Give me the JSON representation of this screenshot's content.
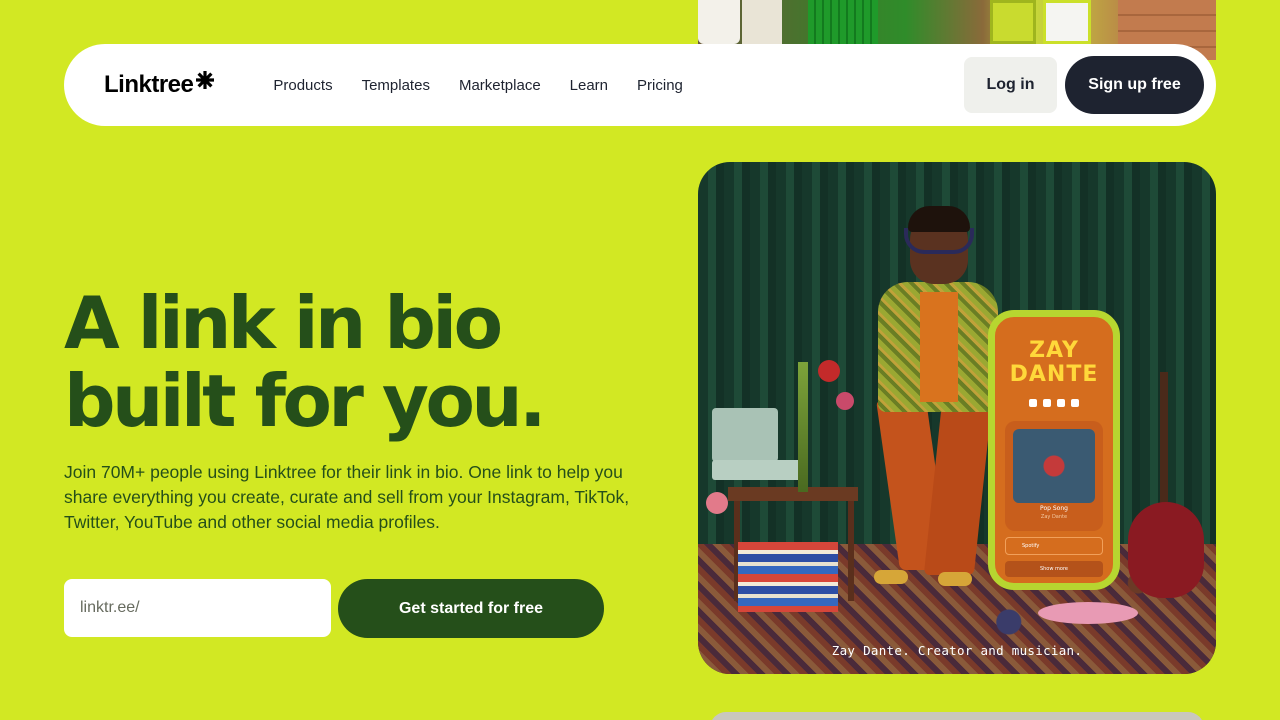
{
  "brand": {
    "logo_text": "Linktree",
    "background_color": "#d2e823",
    "primary_dark_green": "#254f1a",
    "navy": "#1e2330"
  },
  "nav": {
    "links": [
      {
        "label": "Products"
      },
      {
        "label": "Templates"
      },
      {
        "label": "Marketplace"
      },
      {
        "label": "Learn"
      },
      {
        "label": "Pricing"
      }
    ],
    "login_label": "Log in",
    "signup_label": "Sign up free"
  },
  "hero": {
    "title_line1": "A link in bio",
    "title_line2": "built for you.",
    "subtitle": "Join 70M+ people using Linktree for their link in bio. One link to help you share everything you create, curate and sell from your Instagram, TikTok, Twitter, YouTube and other social media profiles.",
    "input_placeholder": "linktr.ee/",
    "cta_label": "Get started for free"
  },
  "hero_image": {
    "caption": "Zay Dante. Creator and musician.",
    "phone_title_line1": "ZAY",
    "phone_title_line2": "DANTE",
    "phone_song": "Pop Song",
    "phone_artist": "Zay Dante",
    "phone_link": "Spotify",
    "phone_button": "Show more"
  },
  "icons": {
    "logo_mark": "asterisk-icon"
  }
}
